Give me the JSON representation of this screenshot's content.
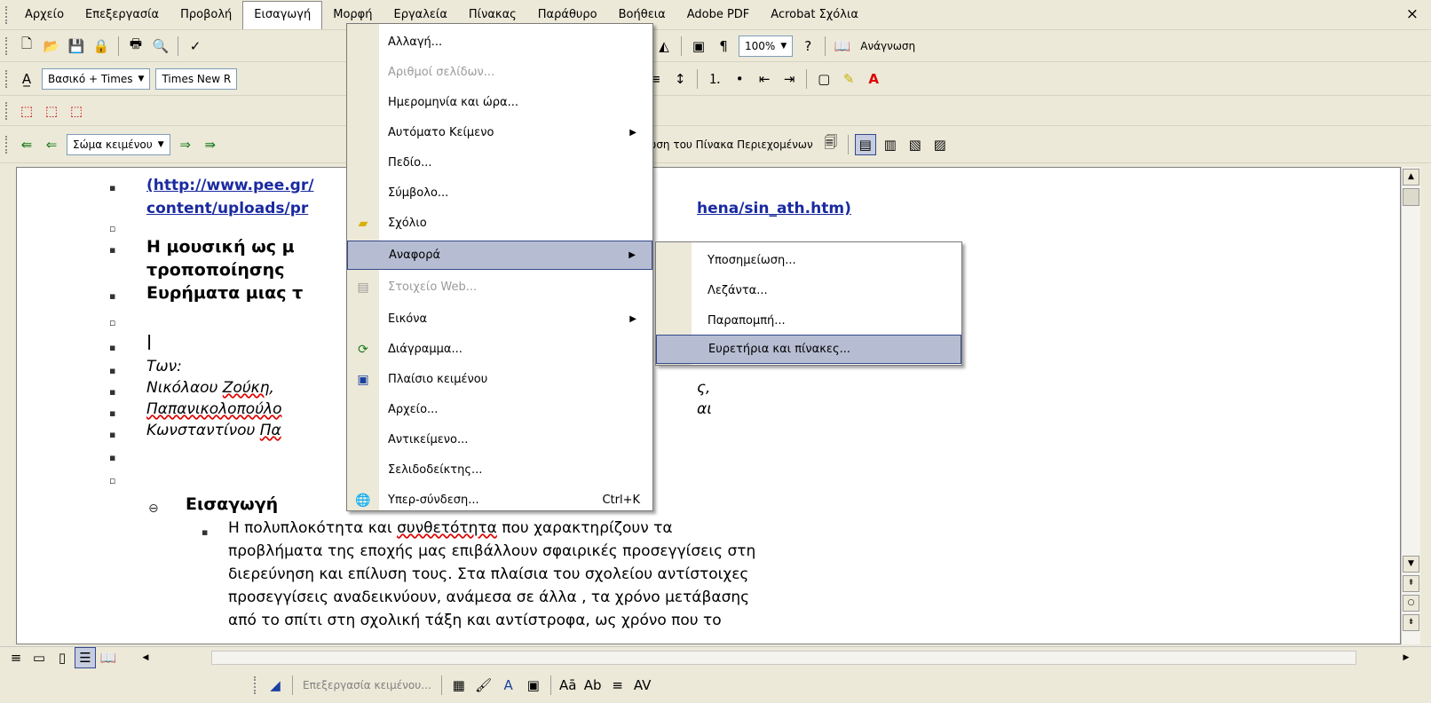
{
  "menubar": {
    "items": [
      "Αρχείο",
      "Επεξεργασία",
      "Προβολή",
      "Εισαγωγή",
      "Μορφή",
      "Εργαλεία",
      "Πίνακας",
      "Παράθυρο",
      "Βοήθεια",
      "Adobe PDF",
      "Acrobat Σχόλια"
    ],
    "close": "×"
  },
  "toolbar1": {
    "zoom": "100%",
    "read_label": "Ανάγνωση",
    "pilcrow": "¶"
  },
  "toolbar2": {
    "style": "Βασικό + Times",
    "font": "Times New R"
  },
  "outline_toolbar": {
    "level": "Σώμα κειμένου",
    "update_toc": "Ενημέρωση του Πίνακα Περιεχομένων"
  },
  "document": {
    "link1": "(http://www.pee.gr/",
    "link2a": "content/uploads/pr",
    "link2b": "hena/sin_ath.htm)",
    "heading1a": "Η μουσική ως μ",
    "heading1b": "τροποποίησης",
    "heading2": "Ευρήματα μιας τ",
    "authors_label": "Των:",
    "author1a": "Νικόλαου ",
    "author1b": "Ζούκη",
    "author1c": ", ",
    "author1tail": "ς,",
    "author2a": "Παπανικολοπούλο",
    "author2tail": "αι",
    "author3a": "Κωνσταντίνου ",
    "author3b": "Πα",
    "section": "Εισαγωγή",
    "para": [
      "Η πολυπλοκότητα και ",
      "συνθετότητα",
      " που χαρακτηρίζουν τα",
      "προβλήματα της εποχής μας επιβάλλουν σφαιρικές προσεγγίσεις στη",
      "διερεύνηση και επίλυση τους. Στα πλαίσια του σχολείου αντίστοιχες",
      "προσεγγίσεις αναδεικνύουν, ανάμεσα σε άλλα , τα χρόνο μετάβασης",
      "από το σπίτι στη σχολική τάξη και αντίστροφα, ως χρόνο που το"
    ]
  },
  "insert_menu": {
    "items": [
      {
        "label": "Αλλαγή...",
        "icon": "",
        "disabled": false,
        "submenu": false,
        "shortcut": ""
      },
      {
        "label": "Αριθμοί σελίδων...",
        "icon": "",
        "disabled": true,
        "submenu": false,
        "shortcut": ""
      },
      {
        "label": "Ημερομηνία και ώρα...",
        "icon": "",
        "disabled": false,
        "submenu": false,
        "shortcut": ""
      },
      {
        "label": "Αυτόματο Κείμενο",
        "icon": "",
        "disabled": false,
        "submenu": true,
        "shortcut": ""
      },
      {
        "label": "Πεδίο...",
        "icon": "",
        "disabled": false,
        "submenu": false,
        "shortcut": ""
      },
      {
        "label": "Σύμβολο...",
        "icon": "",
        "disabled": false,
        "submenu": false,
        "shortcut": ""
      },
      {
        "label": "Σχόλιο",
        "icon": "folder-icon",
        "disabled": false,
        "submenu": false,
        "shortcut": ""
      },
      {
        "label": "Αναφορά",
        "icon": "",
        "disabled": false,
        "submenu": true,
        "shortcut": "",
        "highlight": true
      },
      {
        "label": "Στοιχείο Web...",
        "icon": "web-component-icon",
        "disabled": true,
        "submenu": false,
        "shortcut": ""
      },
      {
        "label": "Εικόνα",
        "icon": "",
        "disabled": false,
        "submenu": true,
        "shortcut": ""
      },
      {
        "label": "Διάγραμμα...",
        "icon": "diagram-icon",
        "disabled": false,
        "submenu": false,
        "shortcut": ""
      },
      {
        "label": "Πλαίσιο κειμένου",
        "icon": "textbox-icon",
        "disabled": false,
        "submenu": false,
        "shortcut": ""
      },
      {
        "label": "Αρχείο...",
        "icon": "",
        "disabled": false,
        "submenu": false,
        "shortcut": ""
      },
      {
        "label": "Αντικείμενο...",
        "icon": "",
        "disabled": false,
        "submenu": false,
        "shortcut": ""
      },
      {
        "label": "Σελιδοδείκτης...",
        "icon": "",
        "disabled": false,
        "submenu": false,
        "shortcut": ""
      },
      {
        "label": "Υπερ-σύνδεση...",
        "icon": "hyperlink-icon",
        "disabled": false,
        "submenu": false,
        "shortcut": "Ctrl+K"
      }
    ]
  },
  "reference_submenu": {
    "items": [
      {
        "label": "Υποσημείωση...",
        "highlight": false
      },
      {
        "label": "Λεζάντα...",
        "highlight": false
      },
      {
        "label": "Παραπομπή...",
        "highlight": false
      },
      {
        "label": "Ευρετήρια και πίνακες...",
        "highlight": true
      }
    ]
  },
  "bottom_toolbar": {
    "edit_text": "Επεξεργασία κειμένου..."
  }
}
